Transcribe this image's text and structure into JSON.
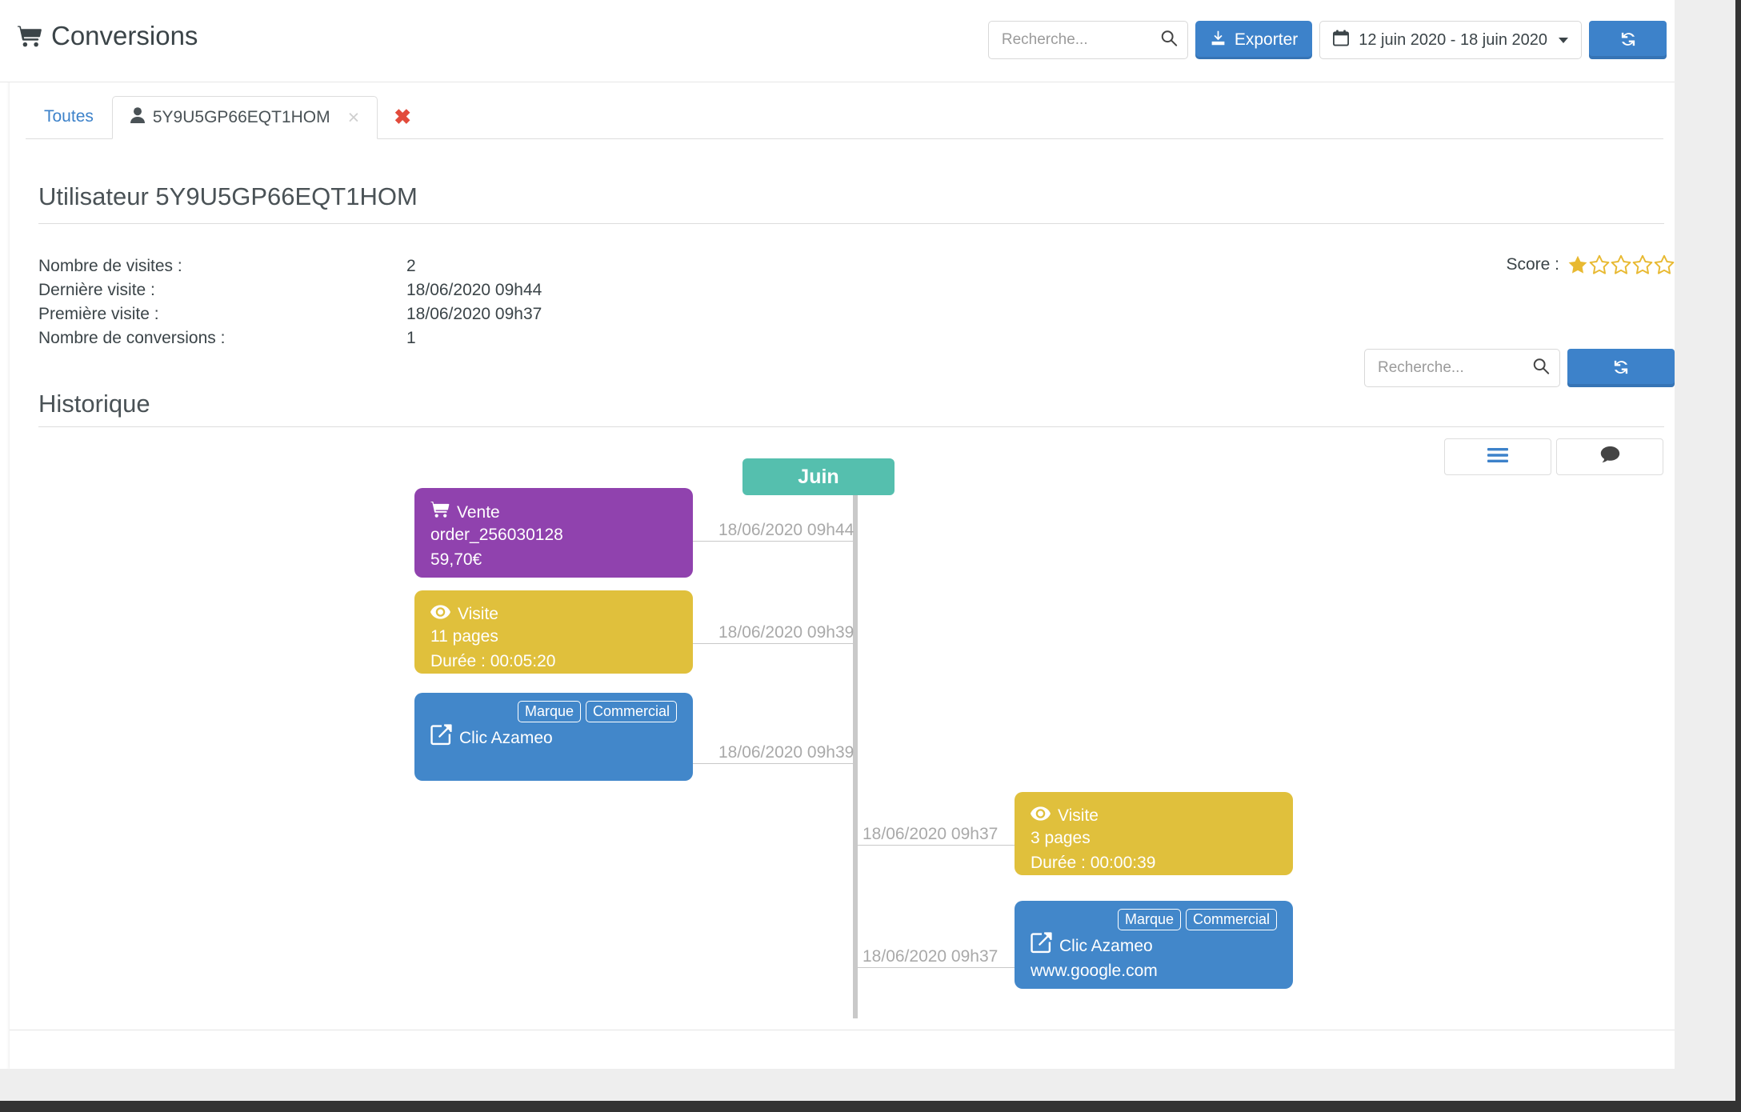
{
  "header": {
    "title": "Conversions",
    "cart_icon": "shopping-cart-icon",
    "search_placeholder": "Recherche...",
    "search_value": "",
    "export_label": "Exporter",
    "export_icon": "download-icon",
    "date_range": "12 juin 2020 - 18 juin 2020",
    "calendar_icon": "calendar-icon",
    "refresh_icon": "refresh-icon",
    "accent_color": "#3d82ca"
  },
  "tabs": {
    "all_label": "Toutes",
    "user_tab_label": "5Y9U5GP66EQT1HOM",
    "user_icon": "user-icon",
    "tab_close": "×",
    "close_all": "✖"
  },
  "user": {
    "section_title": "Utilisateur 5Y9U5GP66EQT1HOM",
    "rows": [
      {
        "label": "Nombre de visites :",
        "value": "2"
      },
      {
        "label": "Dernière visite :",
        "value": "18/06/2020 09h44"
      },
      {
        "label": "Première visite :",
        "value": "18/06/2020 09h37"
      },
      {
        "label": "Nombre de conversions :",
        "value": "1"
      }
    ],
    "score_label": "Score :",
    "score_value": 1,
    "score_max": 5,
    "star_color": "#e8b931"
  },
  "mid_controls": {
    "search_placeholder": "Recherche...",
    "search_value": "",
    "refresh_icon": "refresh-icon"
  },
  "history": {
    "section_title": "Historique",
    "view_list_icon": "list-view-icon",
    "view_comment_icon": "comment-view-icon",
    "month_label": "Juin",
    "month_color": "#55bfae",
    "events": [
      {
        "id": "evt-vente",
        "side": "left",
        "type": "Vente",
        "icon": "shopping-cart-icon",
        "color": "#9042ae",
        "lines": [
          "order_256030128",
          "59,70€"
        ],
        "badges": [],
        "timestamp": "18/06/2020 09h44"
      },
      {
        "id": "evt-visite-1",
        "side": "left",
        "type": "Visite",
        "icon": "eye-icon",
        "color": "#e0c03c",
        "lines": [
          "11 pages",
          "Durée : 00:05:20"
        ],
        "badges": [],
        "timestamp": "18/06/2020 09h39"
      },
      {
        "id": "evt-clic-1",
        "side": "left",
        "type": "Clic Azameo",
        "icon": "external-link-icon",
        "color": "#4287ca",
        "lines": [],
        "badges": [
          "Marque",
          "Commercial"
        ],
        "timestamp": "18/06/2020 09h39"
      },
      {
        "id": "evt-visite-2",
        "side": "right",
        "type": "Visite",
        "icon": "eye-icon",
        "color": "#e0c03c",
        "lines": [
          "3 pages",
          "Durée : 00:00:39"
        ],
        "badges": [],
        "timestamp": "18/06/2020 09h37"
      },
      {
        "id": "evt-clic-2",
        "side": "right",
        "type": "Clic Azameo",
        "icon": "external-link-icon",
        "color": "#4287ca",
        "lines": [
          "www.google.com"
        ],
        "badges": [
          "Marque",
          "Commercial"
        ],
        "timestamp": "18/06/2020 09h37"
      }
    ]
  }
}
